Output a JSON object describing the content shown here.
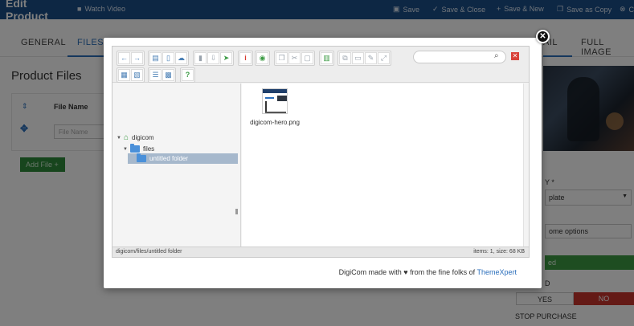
{
  "header": {
    "title": "Edit Product",
    "watch_video": "Watch Video",
    "save": "Save",
    "save_close": "Save & Close",
    "save_new": "Save & New",
    "save_copy": "Save as Copy",
    "close_partial": "C"
  },
  "tabs": {
    "general": "GENERAL",
    "files": "FILES",
    "detail_partial": "AIL",
    "full_image": "FULL IMAGE"
  },
  "product_files": {
    "title": "Product Files",
    "column_file_name": "File Name",
    "file_name_placeholder": "File Name",
    "add_file": "Add File +"
  },
  "side_panel": {
    "category_label_partial": "Y *",
    "template_partial": "plate",
    "options_partial": "ome options",
    "green_partial": "ed",
    "label_partial": "D",
    "yes": "YES",
    "no": "NO",
    "stop_purchase": "STOP PURCHASE"
  },
  "file_manager": {
    "search_placeholder": "",
    "tree": {
      "root": "digicom",
      "child": "files",
      "selected": "untitled folder"
    },
    "files": [
      {
        "name": "digicom-hero.png"
      }
    ],
    "status_path": "digicom/files/untitled folder",
    "status_info": "items: 1, size: 68 KB"
  },
  "footer": {
    "text": "DigiCom made with",
    "heart": "♥",
    "text2": "from the fine folks of",
    "link": "ThemeXpert"
  },
  "colors": {
    "brand_blue": "#1a4e89",
    "accent_green": "#3b9a43",
    "accent_red": "#c8342d",
    "link_blue": "#2a6ebb"
  }
}
